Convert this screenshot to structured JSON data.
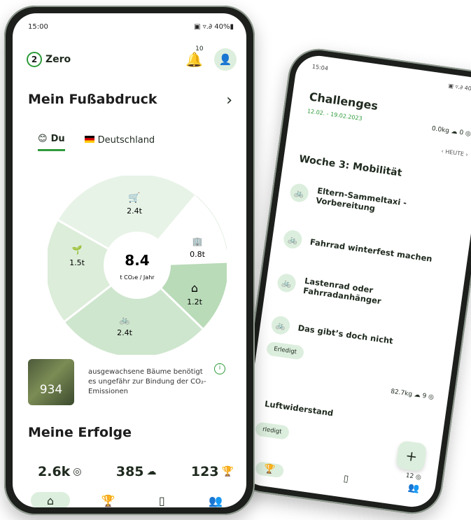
{
  "front": {
    "status": {
      "time": "15:00",
      "icons": "▣ ▿.∂ 40%▮"
    },
    "app": {
      "logo_mark": "2",
      "name": "Zero",
      "notification_count": "10"
    },
    "footprint": {
      "title": "Mein Fußabdruck",
      "tab_you": "Du",
      "tab_country": "Deutschland",
      "total": "8.4",
      "unit": "t CO₂e / Jahr",
      "segments": [
        {
          "icon": "🛒",
          "value": "2.4t"
        },
        {
          "icon": "🏢",
          "value": "0.8t"
        },
        {
          "icon": "⌂",
          "value": "1.2t"
        },
        {
          "icon": "🚲",
          "value": "2.4t"
        },
        {
          "icon": "🌱",
          "value": "1.5t"
        }
      ]
    },
    "trees": {
      "count": "934",
      "text": "ausgewachsene Bäume benötigt es ungefähr zur Bindung der CO₂-Emissionen"
    },
    "achievements": {
      "title": "Meine Erfolge",
      "stat1": "2.6k",
      "stat2": "385",
      "stat3": "123"
    }
  },
  "back": {
    "status": {
      "time": "15:04",
      "icons": "▣ ▿.∂ 40%▮"
    },
    "title": "Challenges",
    "date_range": "12.02. - 19.02.2023",
    "score": "0.0kg ☁ 0 ◎",
    "today": "‹  HEUTE  ›",
    "week": "Woche 3: Mobilität",
    "items": [
      "Eltern-Sammeltaxi - Vorbereitung",
      "Fahrrad winterfest machen",
      "Lastenrad oder Fahrradanhänger",
      "Das gibt’s doch nicht"
    ],
    "done_label": "Erledigt",
    "meta": "82.7kg ☁ 9 ◎",
    "sub": "Luftwiderstand",
    "done_label2": "rledigt",
    "fab": "+",
    "meta2": "12 ◎"
  }
}
